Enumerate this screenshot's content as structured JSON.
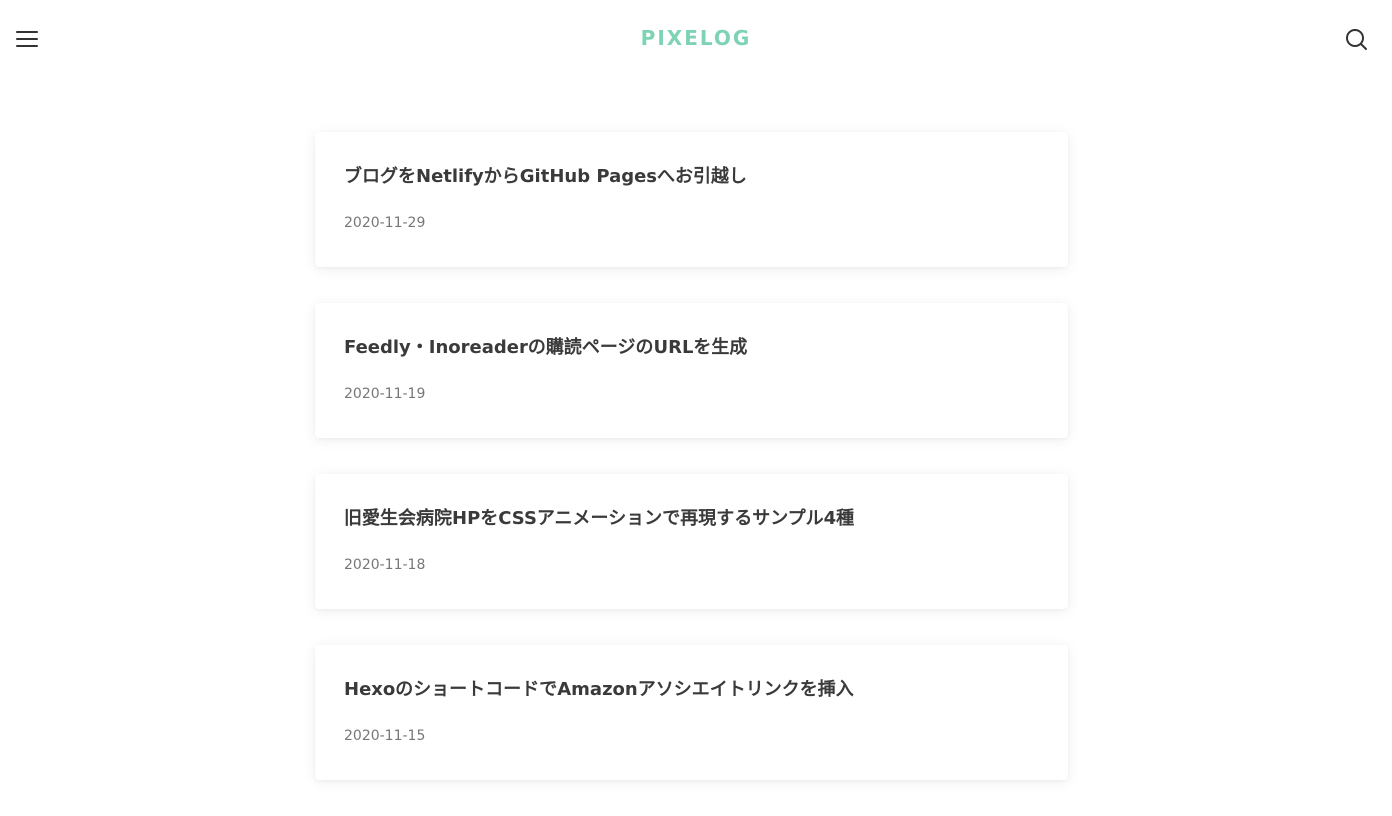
{
  "header": {
    "logo_text": "PIXELOG",
    "menu_icon": "hamburger-menu-icon",
    "search_icon": "search-icon",
    "accent_color": "#7fd3b5"
  },
  "posts": [
    {
      "title": "ブログをNetlifyからGitHub Pagesへお引越し",
      "date": "2020-11-29"
    },
    {
      "title": "Feedly・Inoreaderの購読ページのURLを生成",
      "date": "2020-11-19"
    },
    {
      "title": "旧愛生会病院HPをCSSアニメーションで再現するサンプル4種",
      "date": "2020-11-18"
    },
    {
      "title": "HexoのショートコードでAmazonアソシエイトリンクを挿入",
      "date": "2020-11-15"
    }
  ]
}
